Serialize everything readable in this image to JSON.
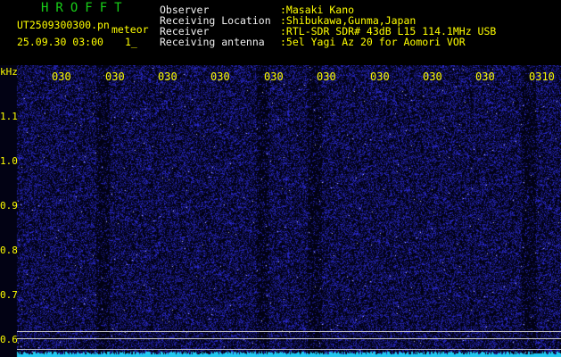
{
  "header": {
    "app_title": "HROFFT",
    "filename": "UT2509300300.pn",
    "mode": "meteor",
    "date_time": "25.09.30 03:00",
    "counter": "1_",
    "fields": [
      {
        "label": "Observer",
        "value": ":Masaki Kano"
      },
      {
        "label": "Receiving Location",
        "value": ":Shibukawa,Gunma,Japan"
      },
      {
        "label": "Receiver",
        "value": ":RTL-SDR SDR# 43dB L15 114.1MHz USB"
      },
      {
        "label": "Receiving antenna",
        "value": ":5el Yagi Az 20 for Aomori VOR"
      }
    ]
  },
  "spectrogram": {
    "freq_unit": "kHz",
    "freq_ticks": [
      "1.1",
      "1.0",
      "0.9",
      "0.8",
      "0.7",
      "0.6"
    ],
    "time_ticks": [
      "030",
      "030",
      "030",
      "030",
      "030",
      "030",
      "030",
      "030",
      "030",
      "0310"
    ],
    "colors": {
      "background": "#020214",
      "noise": "#2a2ad8",
      "trace": "#22c8f0",
      "labels": "#ffff00"
    }
  }
}
